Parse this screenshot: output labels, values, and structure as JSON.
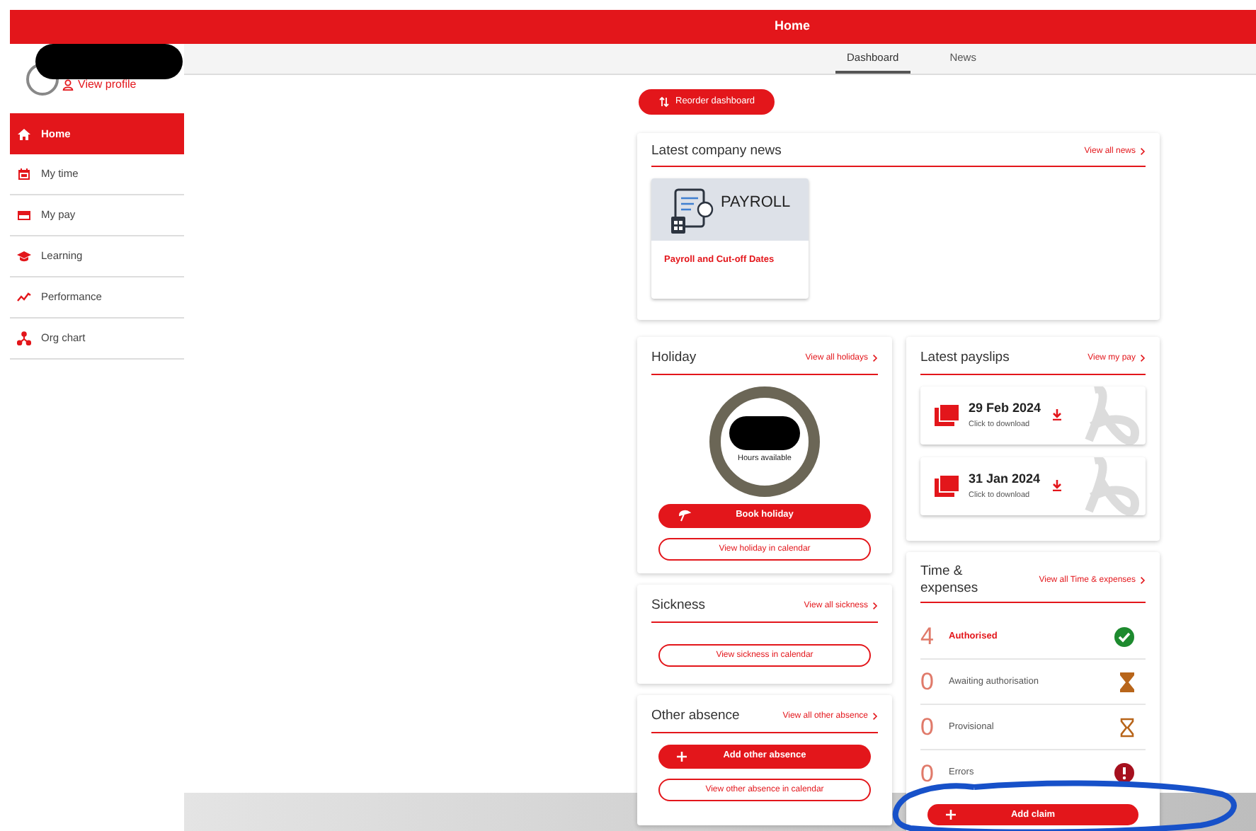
{
  "header": {
    "title": "Home"
  },
  "tabs": [
    {
      "label": "Dashboard",
      "selected": true
    },
    {
      "label": "News",
      "selected": false
    }
  ],
  "profile": {
    "link": "View profile"
  },
  "sidebar": {
    "items": [
      {
        "label": "Home",
        "kind": "home",
        "selected": true
      },
      {
        "label": "My time",
        "kind": "calendar",
        "selected": false
      },
      {
        "label": "My pay",
        "kind": "card",
        "selected": false
      },
      {
        "label": "Learning",
        "kind": "cap",
        "selected": false
      },
      {
        "label": "Performance",
        "kind": "trend",
        "selected": false
      },
      {
        "label": "Org chart",
        "kind": "org",
        "selected": false
      }
    ]
  },
  "reorder_button": "Reorder dashboard",
  "news": {
    "title": "Latest company news",
    "link": "View all news",
    "items": [
      {
        "image_text": "PAYROLL",
        "title": "Payroll and Cut-off Dates"
      }
    ]
  },
  "holiday": {
    "title": "Holiday",
    "link": "View all holidays",
    "caption": "Hours available",
    "buttons": [
      {
        "label": "Book holiday",
        "kind": "umbrella"
      },
      {
        "label": "View holiday in calendar",
        "kind": "outline"
      }
    ]
  },
  "payslips": {
    "title": "Latest payslips",
    "link": "View my pay",
    "items": [
      {
        "date": "29 Feb 2024",
        "hint": "Click to download"
      },
      {
        "date": "31 Jan 2024",
        "hint": "Click to download"
      }
    ]
  },
  "sickness": {
    "title": "Sickness",
    "link": "View all sickness",
    "buttons": [
      {
        "label": "View sickness in calendar",
        "kind": "outline"
      }
    ]
  },
  "other_absence": {
    "title": "Other absence",
    "link": "View all other absence",
    "buttons": [
      {
        "label": "Add other absence",
        "kind": "plus"
      },
      {
        "label": "View other absence in calendar",
        "kind": "outline"
      }
    ]
  },
  "time_expenses": {
    "title": "Time & expenses",
    "link": "View all Time & expenses",
    "rows": [
      {
        "count": "4",
        "label": "Authorised",
        "kind": "authorised"
      },
      {
        "count": "0",
        "label": "Awaiting authorisation",
        "kind": "awaiting"
      },
      {
        "count": "0",
        "label": "Provisional",
        "kind": "provisional"
      },
      {
        "count": "0",
        "label": "Errors",
        "kind": "error"
      }
    ],
    "button": "Add claim"
  }
}
